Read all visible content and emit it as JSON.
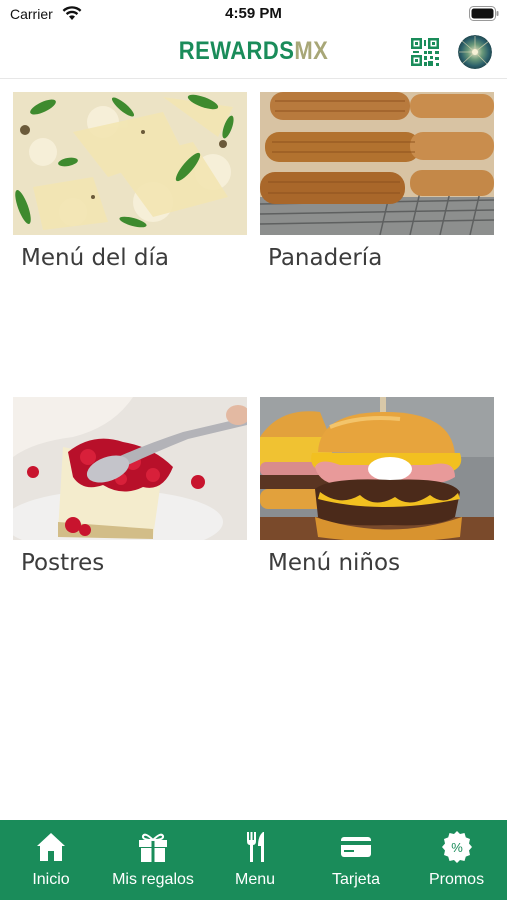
{
  "status_bar": {
    "carrier": "Carrier",
    "time": "4:59 PM"
  },
  "header": {
    "brand_part1": "REWARDS",
    "brand_part2": "MX",
    "brand_color1": "#1a8c5a",
    "brand_color2": "#a8a777"
  },
  "categories": [
    {
      "label": "Menú del día",
      "image": "risotto-photo"
    },
    {
      "label": "Panadería",
      "image": "churros-photo"
    },
    {
      "label": "Postres",
      "image": "cheesecake-photo"
    },
    {
      "label": "Menú niños",
      "image": "burger-photo"
    }
  ],
  "tabbar": {
    "color": "#1a8c5a",
    "items": [
      {
        "label": "Inicio",
        "icon": "home-icon"
      },
      {
        "label": "Mis regalos",
        "icon": "gift-icon"
      },
      {
        "label": "Menu",
        "icon": "fork-knife-icon"
      },
      {
        "label": "Tarjeta",
        "icon": "card-icon"
      },
      {
        "label": "Promos",
        "icon": "percent-badge-icon"
      }
    ]
  }
}
